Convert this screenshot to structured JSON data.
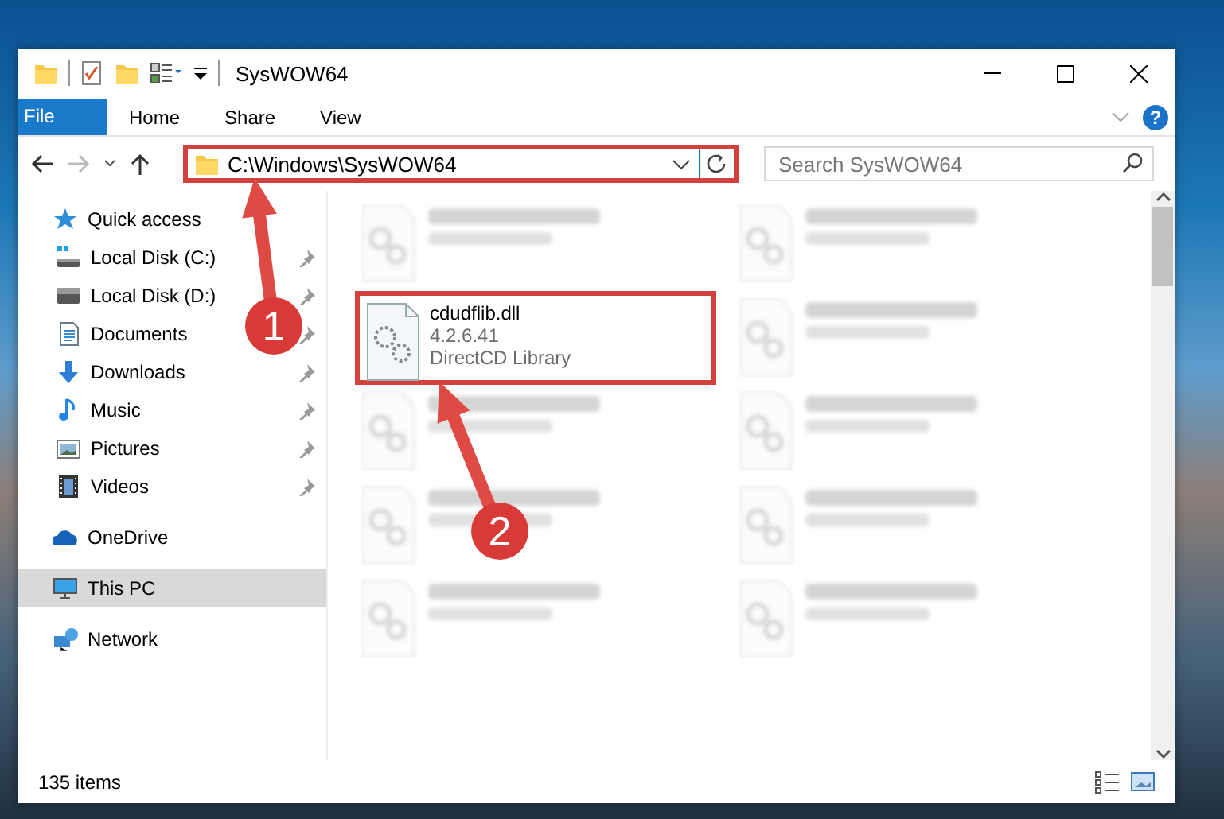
{
  "window": {
    "title": "SysWOW64"
  },
  "ribbon": {
    "tabs": [
      {
        "label": "File",
        "kind": "file"
      },
      {
        "label": "Home",
        "kind": "tab"
      },
      {
        "label": "Share",
        "kind": "tab"
      },
      {
        "label": "View",
        "kind": "tab"
      }
    ],
    "help": "?"
  },
  "address": {
    "path": "C:\\Windows\\SysWOW64",
    "highlighted": true
  },
  "search": {
    "placeholder": "Search SysWOW64"
  },
  "sidebar": {
    "items": [
      {
        "label": "Quick access",
        "kind": "star",
        "pinned": false,
        "selected": false,
        "group": true
      },
      {
        "label": "Local Disk (C:)",
        "kind": "disk-c",
        "pinned": true,
        "selected": false,
        "group": false
      },
      {
        "label": "Local Disk (D:)",
        "kind": "disk",
        "pinned": true,
        "selected": false,
        "group": false
      },
      {
        "label": "Documents",
        "kind": "documents",
        "pinned": true,
        "selected": false,
        "group": false
      },
      {
        "label": "Downloads",
        "kind": "downloads",
        "pinned": true,
        "selected": false,
        "group": false
      },
      {
        "label": "Music",
        "kind": "music",
        "pinned": true,
        "selected": false,
        "group": false
      },
      {
        "label": "Pictures",
        "kind": "pictures",
        "pinned": true,
        "selected": false,
        "group": false
      },
      {
        "label": "Videos",
        "kind": "videos",
        "pinned": true,
        "selected": false,
        "group": false
      },
      {
        "label": "OneDrive",
        "kind": "cloud",
        "pinned": false,
        "selected": false,
        "group": true
      },
      {
        "label": "This PC",
        "kind": "pc",
        "pinned": false,
        "selected": true,
        "group": true
      },
      {
        "label": "Network",
        "kind": "network",
        "pinned": false,
        "selected": false,
        "group": true
      }
    ]
  },
  "files": [
    {
      "kind": "blurred"
    },
    {
      "kind": "blurred"
    },
    {
      "kind": "file",
      "name": "cdudflib.dll",
      "lines": [
        "4.2.6.41",
        "DirectCD Library"
      ],
      "highlighted": true
    },
    {
      "kind": "blurred"
    },
    {
      "kind": "blurred"
    },
    {
      "kind": "blurred"
    },
    {
      "kind": "blurred"
    },
    {
      "kind": "blurred"
    },
    {
      "kind": "blurred"
    },
    {
      "kind": "blurred"
    }
  ],
  "status_bar": {
    "count": "135 items"
  },
  "annotations": [
    {
      "label": "1"
    },
    {
      "label": "2"
    }
  ]
}
